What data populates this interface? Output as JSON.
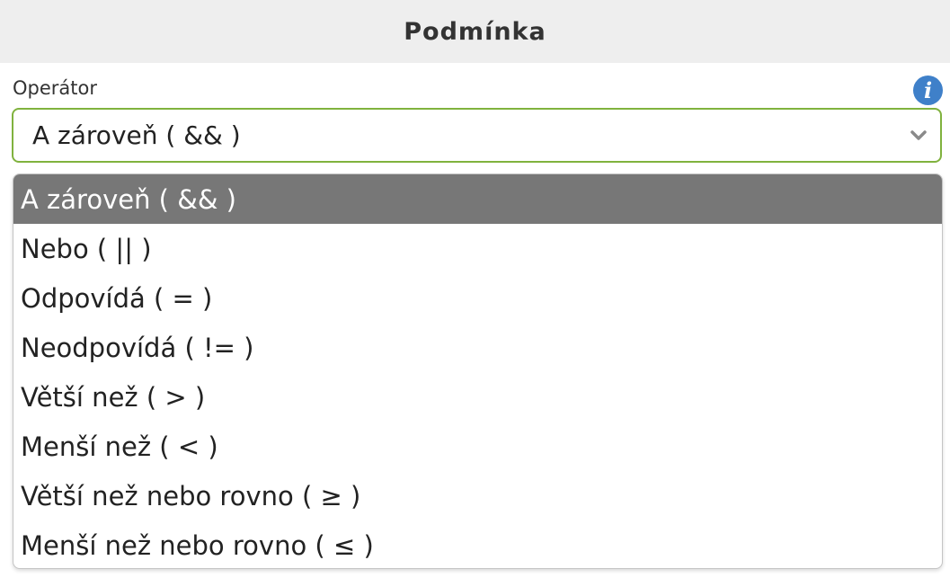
{
  "header": {
    "title": "Podmínka"
  },
  "field": {
    "label": "Operátor",
    "selected_value": "A zároveň ( && )",
    "info_icon": "info-icon",
    "accent_color": "#80b23e"
  },
  "dropdown": {
    "selected_index": 0,
    "options": [
      {
        "label": "A zároveň ( && )"
      },
      {
        "label": "Nebo ( || )"
      },
      {
        "label": "Odpovídá ( = )"
      },
      {
        "label": "Neodpovídá ( != )"
      },
      {
        "label": "Větší než ( > )"
      },
      {
        "label": "Menší než ( < )"
      },
      {
        "label": "Větší než nebo rovno ( ≥ )"
      },
      {
        "label": "Menší než nebo rovno ( ≤ )"
      }
    ]
  }
}
